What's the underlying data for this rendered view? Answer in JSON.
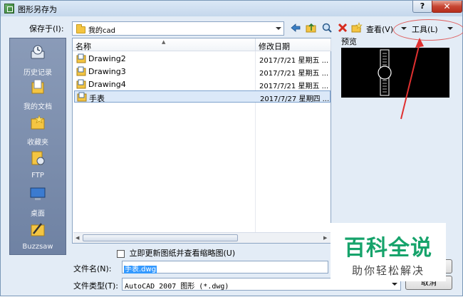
{
  "window": {
    "title": "图形另存为",
    "help_label": "?",
    "close_label": "✕"
  },
  "toolbar": {
    "save_in_label": "保存于(I):",
    "location": "我的cad",
    "views_label": "查看(V)",
    "tools_label": "工具(L)"
  },
  "places": [
    {
      "label": "历史记录",
      "icon": "history-icon"
    },
    {
      "label": "我的文档",
      "icon": "documents-icon"
    },
    {
      "label": "收藏夹",
      "icon": "favorites-icon"
    },
    {
      "label": "FTP",
      "icon": "ftp-icon"
    },
    {
      "label": "桌面",
      "icon": "desktop-icon"
    },
    {
      "label": "Buzzsaw",
      "icon": "buzzsaw-icon"
    }
  ],
  "file_list": {
    "columns": {
      "name": "名称",
      "modified": "修改日期"
    },
    "rows": [
      {
        "name": "Drawing2",
        "date": "2017/7/21 星期五 ..."
      },
      {
        "name": "Drawing3",
        "date": "2017/7/21 星期五 ..."
      },
      {
        "name": "Drawing4",
        "date": "2017/7/21 星期五 ..."
      },
      {
        "name": "手表",
        "date": "2017/7/27 星期四 ..."
      }
    ]
  },
  "preview": {
    "label": "预览"
  },
  "options": {
    "update_thumbnail": "立即更新图纸并查看缩略图(U)"
  },
  "fields": {
    "filename_label": "文件名(N):",
    "filename_value": "手表.dwg",
    "filetype_label": "文件类型(T):",
    "filetype_value": "AutoCAD 2007 图形 (*.dwg)"
  },
  "buttons": {
    "cancel": "取消"
  },
  "watermark": {
    "title": "百科全说",
    "subtitle": "助你轻松解决"
  },
  "colors": {
    "annotation": "#e03030",
    "watermark_green": "#16a36b"
  }
}
